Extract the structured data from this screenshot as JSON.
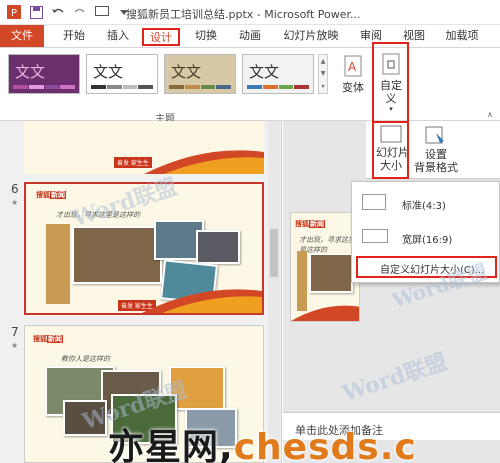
{
  "window": {
    "title": "搜狐新员工培训总结.pptx - Microsoft Power..."
  },
  "ribbon_tabs": [
    {
      "label": "文件"
    },
    {
      "label": "开始"
    },
    {
      "label": "插入"
    },
    {
      "label": "设计"
    },
    {
      "label": "切换"
    },
    {
      "label": "动画"
    },
    {
      "label": "幻灯片放映"
    },
    {
      "label": "审阅"
    },
    {
      "label": "视图"
    },
    {
      "label": "加载项"
    }
  ],
  "themes": [
    {
      "label": "文文"
    },
    {
      "label": "文文"
    },
    {
      "label": "文文"
    },
    {
      "label": "文文"
    }
  ],
  "ribbon": {
    "group_themes_label": "主题",
    "variant_label": "变体",
    "customize_label": "自定\n义",
    "slide_size_label": "幻灯片\n大小",
    "format_bg_label": "设置\n背景格式"
  },
  "slides": [
    {
      "number": "6",
      "slogan": "才出现，寻求这里是这样的",
      "footer": "奋发  家生生"
    },
    {
      "number": "7",
      "slogan": "教你人是这样的",
      "footer": ""
    }
  ],
  "slide_size_menu": {
    "items": [
      {
        "label": "标准(4:3)"
      },
      {
        "label": "宽屏(16:9)"
      }
    ],
    "custom_label": "自定义幻灯片大小(C)..."
  },
  "notes": {
    "placeholder": "单击此处添加备注"
  },
  "watermark": {
    "text": "Word联盟",
    "bottom_text_black": "亦星网,",
    "bottom_text_colored": "chesds.c"
  },
  "colors": {
    "accent": "#D24726",
    "highlight": "#E0241B"
  }
}
